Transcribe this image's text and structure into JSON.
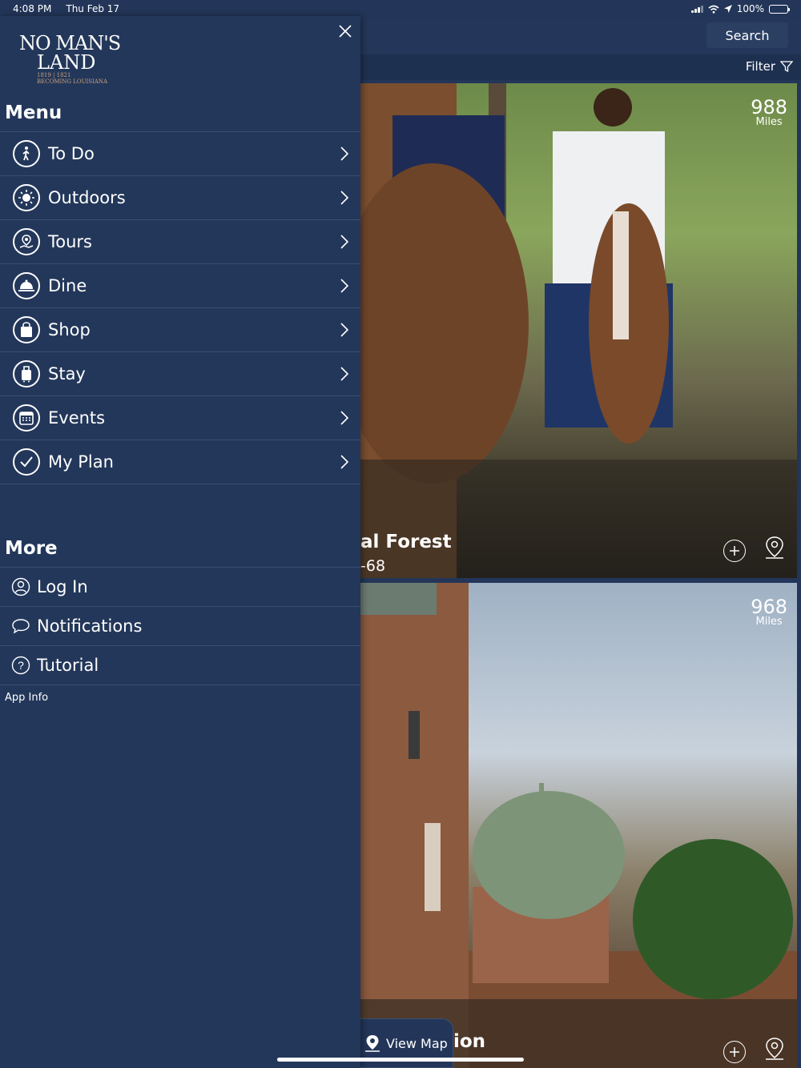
{
  "status": {
    "time": "4:08 PM",
    "date": "Thu Feb 17",
    "battery": "100%"
  },
  "header": {
    "search_label": "Search",
    "filter_label": "Filter"
  },
  "cards": [
    {
      "miles_value": "988",
      "miles_unit": "Miles",
      "title": "al Forest",
      "subtitle": "-68"
    },
    {
      "miles_value": "968",
      "miles_unit": "Miles",
      "title": "ion",
      "subtitle": ""
    }
  ],
  "view_map_label": "View Map",
  "drawer": {
    "logo": {
      "line1": "NO MAN'S",
      "line2": "LAND",
      "line3": "1819 | 1821",
      "line4": "BECOMING LOUISIANA"
    },
    "menu_title": "Menu",
    "menu_items": [
      {
        "label": "To Do",
        "icon": "walking-person-icon"
      },
      {
        "label": "Outdoors",
        "icon": "sun-icon"
      },
      {
        "label": "Tours",
        "icon": "tour-map-icon"
      },
      {
        "label": "Dine",
        "icon": "dining-cloche-icon"
      },
      {
        "label": "Shop",
        "icon": "shopping-bag-icon"
      },
      {
        "label": "Stay",
        "icon": "luggage-icon"
      },
      {
        "label": "Events",
        "icon": "calendar-icon"
      },
      {
        "label": "My Plan",
        "icon": "checkmark-icon"
      }
    ],
    "more_title": "More",
    "more_items": [
      {
        "label": "Log In",
        "icon": "user-icon"
      },
      {
        "label": "Notifications",
        "icon": "chat-bubble-icon"
      },
      {
        "label": "Tutorial",
        "icon": "question-icon"
      }
    ],
    "app_info": "App Info"
  }
}
